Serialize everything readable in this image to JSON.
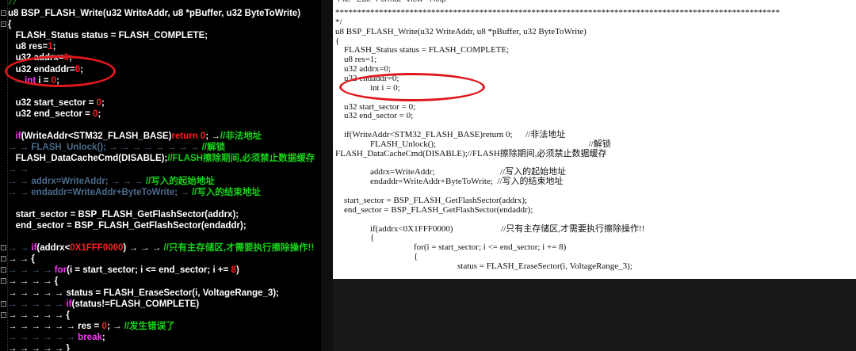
{
  "left_editor": {
    "top_strip": "//",
    "gutter_marks": [
      "-",
      "-",
      "-",
      "-",
      "-",
      "-",
      "-",
      "-"
    ],
    "lines": [
      {
        "segs": [
          {
            "t": "u8 BSP_FLASH_Write(u32 WriteAddr, u8 *pBuffer, u32 ByteToWrite)",
            "c": "#ffffff"
          }
        ]
      },
      {
        "segs": [
          {
            "t": "{",
            "c": "#ffffff"
          }
        ]
      },
      {
        "segs": [
          {
            "t": "   FLASH_Status status = FLASH_COMPLETE;",
            "c": "#ffffff"
          }
        ]
      },
      {
        "segs": [
          {
            "t": "   u8 res=",
            "c": "#ffffff"
          },
          {
            "t": "1",
            "c": "#ff2020"
          },
          {
            "t": ";",
            "c": "#ffffff"
          }
        ]
      },
      {
        "segs": [
          {
            "t": "   u32 addrx=",
            "c": "#ffffff"
          },
          {
            "t": "0",
            "c": "#ff2020"
          },
          {
            "t": ";",
            "c": "#ffffff"
          }
        ]
      },
      {
        "segs": [
          {
            "t": "   u32 endaddr=",
            "c": "#ffffff"
          },
          {
            "t": "0",
            "c": "#ff2020"
          },
          {
            "t": ";",
            "c": "#ffffff"
          }
        ]
      },
      {
        "segs": [
          {
            "t": "  → ",
            "c": "#4a6a8a"
          },
          {
            "t": "int",
            "c": "#ff33ff"
          },
          {
            "t": " i = ",
            "c": "#ffffff"
          },
          {
            "t": "0",
            "c": "#ff2020"
          },
          {
            "t": ";",
            "c": "#ffffff"
          }
        ]
      },
      {
        "segs": [
          {
            "t": "",
            "c": "#ffffff"
          }
        ]
      },
      {
        "segs": [
          {
            "t": "   u32 start_sector = ",
            "c": "#ffffff"
          },
          {
            "t": "0",
            "c": "#ff2020"
          },
          {
            "t": ";",
            "c": "#ffffff"
          }
        ]
      },
      {
        "segs": [
          {
            "t": "   u32 end_sector = ",
            "c": "#ffffff"
          },
          {
            "t": "0",
            "c": "#ff2020"
          },
          {
            "t": ";",
            "c": "#ffffff"
          }
        ]
      },
      {
        "segs": [
          {
            "t": "",
            "c": "#ffffff"
          }
        ]
      },
      {
        "segs": [
          {
            "t": "   ",
            "c": "#ffffff"
          },
          {
            "t": "if",
            "c": "#ff33ff"
          },
          {
            "t": "(WriteAddr<STM32_FLASH_BASE)",
            "c": "#ffffff"
          },
          {
            "t": "return 0",
            "c": "#ff2020"
          },
          {
            "t": "; →",
            "c": "#ffffff"
          },
          {
            "t": "//非法地址",
            "c": "#17d41a"
          }
        ]
      },
      {
        "segs": [
          {
            "t": "→ → FLASH_Unlock(); → → → → → → → → ",
            "c": "#4a6a8a"
          },
          {
            "t": "//解锁",
            "c": "#17d41a"
          }
        ]
      },
      {
        "segs": [
          {
            "t": "   FLASH_DataCacheCmd(DISABLE);",
            "c": "#ffffff"
          },
          {
            "t": "//FLASH擦除期间,必须禁止数据缓存",
            "c": "#17d41a"
          }
        ]
      },
      {
        "segs": [
          {
            "t": "→ →",
            "c": "#4a6a8a"
          }
        ]
      },
      {
        "segs": [
          {
            "t": "→ → addrx=WriteAddr; → → → ",
            "c": "#4a6a8a"
          },
          {
            "t": "//写入的起始地址",
            "c": "#17d41a"
          }
        ]
      },
      {
        "segs": [
          {
            "t": "→ → endaddr=WriteAddr+ByteToWrite; → ",
            "c": "#4a6a8a"
          },
          {
            "t": "//写入的结束地址",
            "c": "#17d41a"
          }
        ]
      },
      {
        "segs": [
          {
            "t": "",
            "c": "#ffffff"
          }
        ]
      },
      {
        "segs": [
          {
            "t": "   start_sector = BSP_FLASH_GetFlashSector(addrx);",
            "c": "#ffffff"
          }
        ]
      },
      {
        "segs": [
          {
            "t": "   end_sector = BSP_FLASH_GetFlashSector(endaddr);",
            "c": "#ffffff"
          }
        ]
      },
      {
        "segs": [
          {
            "t": "",
            "c": "#ffffff"
          }
        ]
      },
      {
        "segs": [
          {
            "t": "→ → ",
            "c": "#4a6a8a"
          },
          {
            "t": "if",
            "c": "#ff33ff"
          },
          {
            "t": "(addrx<",
            "c": "#ffffff"
          },
          {
            "t": "0X1FFF0000",
            "c": "#ff2020"
          },
          {
            "t": ") → → → ",
            "c": "#ffffff"
          },
          {
            "t": "//只有主存储区,才需要执行擦除操作!!",
            "c": "#17d41a"
          }
        ]
      },
      {
        "segs": [
          {
            "t": "→ → {",
            "c": "#ffffff"
          }
        ]
      },
      {
        "segs": [
          {
            "t": "→ → → → ",
            "c": "#4a6a8a"
          },
          {
            "t": "for",
            "c": "#ff33ff"
          },
          {
            "t": "(i = start_sector; i <= end_sector; i += ",
            "c": "#ffffff"
          },
          {
            "t": "8",
            "c": "#ff2020"
          },
          {
            "t": ")",
            "c": "#ffffff"
          }
        ]
      },
      {
        "segs": [
          {
            "t": "→ → → → {",
            "c": "#ffffff"
          }
        ]
      },
      {
        "segs": [
          {
            "t": "→ → → → → status = FLASH_EraseSector(i, VoltageRange_3);",
            "c": "#ffffff"
          }
        ]
      },
      {
        "segs": [
          {
            "t": "→ → → → → ",
            "c": "#4a6a8a"
          },
          {
            "t": "if",
            "c": "#ff33ff"
          },
          {
            "t": "(status!=FLASH_COMPLETE)",
            "c": "#ffffff"
          }
        ]
      },
      {
        "segs": [
          {
            "t": "→ → → → → {",
            "c": "#ffffff"
          }
        ]
      },
      {
        "segs": [
          {
            "t": "→ → → → → → res = ",
            "c": "#ffffff"
          },
          {
            "t": "0",
            "c": "#ff2020"
          },
          {
            "t": "; → ",
            "c": "#ffffff"
          },
          {
            "t": "//发生错误了",
            "c": "#17d41a"
          }
        ]
      },
      {
        "segs": [
          {
            "t": "→ → → → → → ",
            "c": "#4a6a8a"
          },
          {
            "t": "break",
            "c": "#ff33ff"
          },
          {
            "t": ";",
            "c": "#ffffff"
          }
        ]
      },
      {
        "segs": [
          {
            "t": "→ → → → → }",
            "c": "#ffffff"
          }
        ]
      },
      {
        "segs": [
          {
            "t": "→ → → → }",
            "c": "#ffffff"
          }
        ]
      }
    ]
  },
  "notepad": {
    "menu": [
      "File",
      "Edit",
      "Format",
      "View",
      "Help"
    ],
    "lines": [
      "******************************************************************************************************",
      "*/",
      "u8 BSP_FLASH_Write(u32 WriteAddr, u8 *pBuffer, u32 ByteToWrite)",
      "{",
      "    FLASH_Status status = FLASH_COMPLETE;",
      "    u8 res=1;",
      "    u32 addrx=0;",
      "    u32 endaddr=0;",
      "                int i = 0;",
      "",
      "    u32 start_sector = 0;",
      "    u32 end_sector = 0;",
      "",
      "    if(WriteAddr<STM32_FLASH_BASE)return 0;      //非法地址",
      "                FLASH_Unlock();                                                                      //解锁",
      "FLASH_DataCacheCmd(DISABLE);//FLASH擦除期间,必须禁止数据缓存",
      "",
      "                addrx=WriteAddr;                              //写入的起始地址",
      "                endaddr=WriteAddr+ByteToWrite;  //写入的结束地址",
      "",
      "    start_sector = BSP_FLASH_GetFlashSector(addrx);",
      "    end_sector = BSP_FLASH_GetFlashSector(endaddr);",
      "",
      "                if(addrx<0X1FFF0000)                      //只有主存储区,才需要执行擦除操作!!",
      "                {",
      "                                    for(i = start_sector; i <= end_sector; i += 8)",
      "                                    {",
      "                                                        status = FLASH_EraseSector(i, VoltageRange_3);"
    ]
  }
}
